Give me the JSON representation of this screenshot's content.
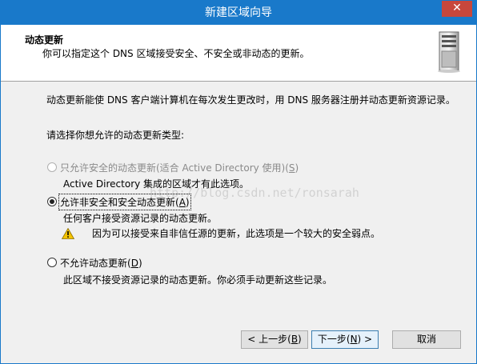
{
  "window": {
    "title": "新建区域向导",
    "close_glyph": "✕"
  },
  "header": {
    "title": "动态更新",
    "description": "你可以指定这个 DNS 区域接受安全、不安全或非动态的更新。",
    "icon": "server-icon"
  },
  "body": {
    "intro": "动态更新能使 DNS 客户端计算机在每次发生更改时，用 DNS 服务器注册并动态更新资源记录。",
    "prompt": "请选择你想允许的动态更新类型:",
    "options": [
      {
        "label": "只允许安全的动态更新(适合 Active Directory 使用)(",
        "key": "S",
        "label_end": ")",
        "desc": "Active Directory 集成的区域才有此选项。",
        "selected": false,
        "enabled": false
      },
      {
        "label": "允许非安全和安全动态更新(",
        "key": "A",
        "label_end": ")",
        "desc": "任何客户接受资源记录的动态更新。",
        "warning": "因为可以接受来自非信任源的更新，此选项是一个较大的安全弱点。",
        "selected": true,
        "enabled": true
      },
      {
        "label": "不允许动态更新(",
        "key": "D",
        "label_end": ")",
        "desc": "此区域不接受资源记录的动态更新。你必须手动更新这些记录。",
        "selected": false,
        "enabled": true
      }
    ],
    "watermark": "http://blog.csdn.net/ronsarah"
  },
  "buttons": {
    "back": {
      "pre": "< 上一步(",
      "key": "B",
      "post": ")"
    },
    "next": {
      "pre": "下一步(",
      "key": "N",
      "post": ") >"
    },
    "cancel": "取消"
  },
  "colors": {
    "titlebar": "#1979ca",
    "close": "#c7473c",
    "warning": "#f5c400"
  }
}
